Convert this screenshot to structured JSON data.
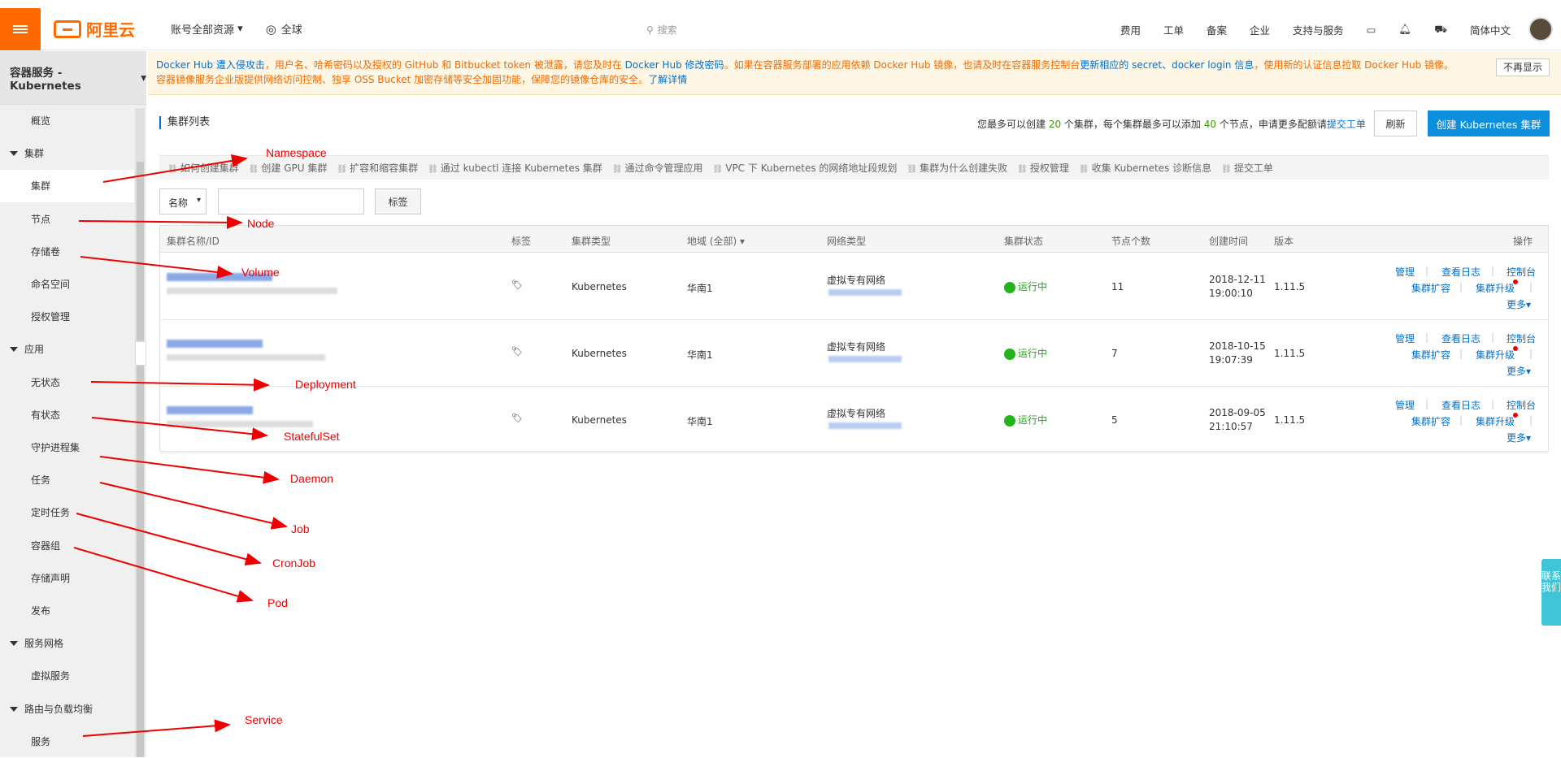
{
  "topbar": {
    "logo_text": "阿里云",
    "account_menu": "账号全部资源",
    "region": "全球",
    "search_placeholder": "搜索",
    "links": [
      "费用",
      "工单",
      "备案",
      "企业",
      "支持与服务"
    ],
    "language": "简体中文",
    "accent_color": "#ff6a00"
  },
  "sidebar": {
    "product": "容器服务 - Kubernetes",
    "items": [
      {
        "label": "概览",
        "level": 1
      },
      {
        "label": "集群",
        "level": 0
      },
      {
        "label": "集群",
        "level": 2,
        "active": true
      },
      {
        "label": "节点",
        "level": 2
      },
      {
        "label": "存储卷",
        "level": 2
      },
      {
        "label": "命名空间",
        "level": 2
      },
      {
        "label": "授权管理",
        "level": 2
      },
      {
        "label": "应用",
        "level": 0
      },
      {
        "label": "无状态",
        "level": 2
      },
      {
        "label": "有状态",
        "level": 2
      },
      {
        "label": "守护进程集",
        "level": 2
      },
      {
        "label": "任务",
        "level": 2
      },
      {
        "label": "定时任务",
        "level": 2
      },
      {
        "label": "容器组",
        "level": 2
      },
      {
        "label": "存储声明",
        "level": 2
      },
      {
        "label": "发布",
        "level": 2
      },
      {
        "label": "服务网格",
        "level": 0
      },
      {
        "label": "虚拟服务",
        "level": 2
      },
      {
        "label": "路由与负载均衡",
        "level": 0
      },
      {
        "label": "服务",
        "level": 2
      }
    ]
  },
  "notice": {
    "line1_a": "Docker Hub ",
    "line1_b": "遭入侵攻击",
    "line1_c": "，用户名、哈希密码以及授权的 GitHub 和 Bitbucket token 被泄露，请您及时在 ",
    "line1_d": "Docker Hub 修改密码",
    "line1_e": "。如果在容器服务部署的应用依赖 Docker Hub 镜像，也请及时在容器服务控制台",
    "line1_f": "更新相应的 secret、docker login 信息",
    "line1_g": "，使用新的认证信息拉取 Docker Hub 镜像。",
    "line2_a": "容器镜像服务企业版提供网络访问控制、独享 OSS Bucket 加密存储等安全加固功能，保障您的镜像仓库的安全。",
    "line2_b": "了解详情",
    "dismiss": "不再显示"
  },
  "main": {
    "title": "集群列表",
    "quota_a": "您最多可以创建 ",
    "quota_clusters": "20",
    "quota_b": " 个集群，每个集群最多可以添加 ",
    "quota_nodes": "40",
    "quota_c": " 个节点，申请更多配额请",
    "quota_link": "提交工单",
    "refresh": "刷新",
    "create": "创建 Kubernetes 集群",
    "help_links": [
      "如何创建集群",
      "创建 GPU 集群",
      "扩容和缩容集群",
      "通过 kubectl 连接 Kubernetes 集群",
      "通过命令管理应用",
      "VPC 下 Kubernetes 的网络地址段规划",
      "集群为什么创建失败",
      "授权管理",
      "收集 Kubernetes 诊断信息",
      "提交工单"
    ],
    "filter_select": "名称",
    "filter_tag": "标签"
  },
  "table": {
    "headers": [
      "集群名称/ID",
      "标签",
      "集群类型",
      "地域 (全部)",
      "网络类型",
      "集群状态",
      "节点个数",
      "创建时间",
      "版本",
      "操作"
    ],
    "rows": [
      {
        "type": "Kubernetes",
        "region": "华南1",
        "network": "虚拟专有网络",
        "status": "运行中",
        "nodes": "11",
        "date": "2018-12-11",
        "time": "19:00:10",
        "version": "1.11.5"
      },
      {
        "type": "Kubernetes",
        "region": "华南1",
        "network": "虚拟专有网络",
        "status": "运行中",
        "nodes": "7",
        "date": "2018-10-15",
        "time": "19:07:39",
        "version": "1.11.5"
      },
      {
        "type": "Kubernetes",
        "region": "华南1",
        "network": "虚拟专有网络",
        "status": "运行中",
        "nodes": "5",
        "date": "2018-09-05",
        "time": "21:10:57",
        "version": "1.11.5"
      }
    ],
    "ops": {
      "manage": "管理",
      "logs": "查看日志",
      "console": "控制台",
      "scale": "集群扩容",
      "upgrade": "集群升级",
      "more": "更多"
    }
  },
  "annotations": [
    "Namespace",
    "Node",
    "Volume",
    "Deployment",
    "StatefulSet",
    "Daemon",
    "Job",
    "CronJob",
    "Pod",
    "Service"
  ],
  "contact": "联系我们"
}
